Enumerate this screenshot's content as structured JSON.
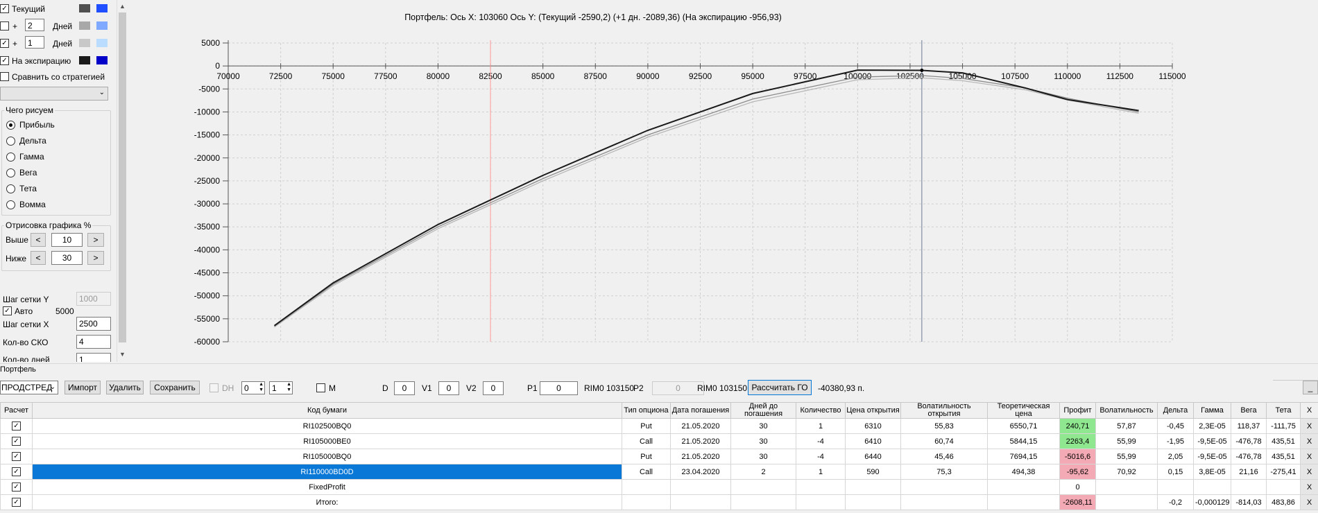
{
  "left": {
    "current_label": "Текущий",
    "plus1": "+",
    "days1": "2",
    "days_label1": "Дней",
    "plus2": "+",
    "days2": "1",
    "days_label2": "Дней",
    "expiry_label": "На экспирацию",
    "compare_label": "Сравнить со стратегией",
    "swatch_colors": [
      "#505050",
      "#1f4fff",
      "#a8a8a8",
      "#7fa8ff",
      "#c8c8c8",
      "#b9dcff",
      "#1a1a1a",
      "#0000c8"
    ],
    "draw_group_title": "Чего рисуем",
    "draw_options": [
      "Прибыль",
      "Дельта",
      "Гамма",
      "Вега",
      "Тета",
      "Вомма"
    ],
    "draw_selected": "Прибыль",
    "render_group_title": "Отрисовка графика %",
    "above_label": "Выше",
    "above_value": "10",
    "below_label": "Ниже",
    "below_value": "30",
    "less_btn": "<",
    "more_btn": ">",
    "grid_y_label": "Шаг сетки Y",
    "grid_y_value": "1000",
    "auto_label": "Авто",
    "auto_value": "5000",
    "grid_x_label": "Шаг сетки X",
    "grid_x_value": "2500",
    "sko_label": "Кол-во СКО",
    "sko_value": "4",
    "days_count_label": "Кол-во дней",
    "days_count_value": "1"
  },
  "chart_header": "Портфель:  Ось X:  103060  Ось Y:   (Текущий -2590,2)   (+1 дн. -2089,36)   (На экспирацию -956,93)",
  "chart_data": {
    "type": "line",
    "title": "Портфель:  Ось X:  103060  Ось Y:   (Текущий -2590,2)   (+1 дн. -2089,36)   (На экспирацию -956,93)",
    "xlim": [
      70000,
      115000
    ],
    "ylim": [
      -60000,
      5000
    ],
    "x_ticks": [
      70000,
      72500,
      75000,
      77500,
      80000,
      82500,
      85000,
      87500,
      90000,
      92500,
      95000,
      97500,
      100000,
      102500,
      105000,
      107500,
      110000,
      112500,
      115000
    ],
    "y_ticks": [
      5000,
      0,
      -5000,
      -10000,
      -15000,
      -20000,
      -25000,
      -30000,
      -35000,
      -40000,
      -45000,
      -50000,
      -55000,
      -60000
    ],
    "grid": true,
    "vlines": [
      {
        "x": 82500,
        "color": "#ff9a9a"
      },
      {
        "x": 103060,
        "color": "#6a7a90"
      }
    ],
    "series": [
      {
        "color": "#1a1a1a",
        "x": [
          72200,
          75000,
          80000,
          85000,
          90000,
          95000,
          100000,
          103060,
          105000,
          108000,
          110000,
          113400
        ],
        "y": [
          -56500,
          -47200,
          -34500,
          -23800,
          -14000,
          -6000,
          -900,
          -956,
          -1500,
          -4800,
          -7300,
          -9700
        ]
      },
      {
        "color": "#8a8a8a",
        "x": [
          72200,
          75000,
          80000,
          85000,
          90000,
          95000,
          100000,
          103060,
          105000,
          108000,
          110000,
          113400
        ],
        "y": [
          -56600,
          -47500,
          -35000,
          -24500,
          -15000,
          -7200,
          -2400,
          -2089,
          -2700,
          -4800,
          -7000,
          -10000
        ]
      },
      {
        "color": "#b8b8b8",
        "x": [
          72200,
          75000,
          80000,
          85000,
          90000,
          95000,
          100000,
          103060,
          105000,
          108000,
          110000,
          113400
        ],
        "y": [
          -56800,
          -47800,
          -35400,
          -25000,
          -15500,
          -7800,
          -3000,
          -2590,
          -3200,
          -5200,
          -7400,
          -10300
        ]
      }
    ]
  },
  "portfolio": {
    "label": "Портфель",
    "mode_select": "ПРОДСТРЕД",
    "import_btn": "Импорт",
    "delete_btn": "Удалить",
    "save_btn": "Сохранить",
    "dh_label": "DH",
    "dh_val1": "0",
    "dh_val2": "1",
    "m_label": "M",
    "d_label": "D",
    "d_value": "0",
    "v1_label": "V1",
    "v1_value": "0",
    "v2_label": "V2",
    "v2_value": "0",
    "p1_label": "P1",
    "p1_value": "0",
    "rim1": "RIM0 103150",
    "p2_label": "P2",
    "p2_value": "0",
    "rim2": "RIM0 103150",
    "calc_go_btn": "Рассчитать ГО",
    "go_value": "-40380,93 п.",
    "minimize_btn": "_"
  },
  "table": {
    "headers": [
      "Расчет",
      "Код бумаги",
      "Тип опциона",
      "Дата погашения",
      "Дней до погашения",
      "Количество",
      "Цена открытия",
      "Волатильность открытия",
      "Теоретическая цена",
      "Профит",
      "Волатильность",
      "Дельта",
      "Гамма",
      "Вега",
      "Тета",
      "X"
    ],
    "rows": [
      {
        "code": "RI102500BQ0",
        "type": "Put",
        "date": "21.05.2020",
        "days": "30",
        "qty": "1",
        "open": "6310",
        "vol_open": "55,83",
        "theor": "6550,71",
        "profit": "240,71",
        "profit_color": "green",
        "vol": "57,87",
        "delta": "-0,45",
        "gamma": "2,3E-05",
        "vega": "118,37",
        "theta": "-111,75",
        "x": "X"
      },
      {
        "code": "RI105000BE0",
        "type": "Call",
        "date": "21.05.2020",
        "days": "30",
        "qty": "-4",
        "open": "6410",
        "vol_open": "60,74",
        "theor": "5844,15",
        "profit": "2263,4",
        "profit_color": "green",
        "vol": "55,99",
        "delta": "-1,95",
        "gamma": "-9,5E-05",
        "vega": "-476,78",
        "theta": "435,51",
        "x": "X"
      },
      {
        "code": "RI105000BQ0",
        "type": "Put",
        "date": "21.05.2020",
        "days": "30",
        "qty": "-4",
        "open": "6440",
        "vol_open": "45,46",
        "theor": "7694,15",
        "profit": "-5016,6",
        "profit_color": "red",
        "vol": "55,99",
        "delta": "2,05",
        "gamma": "-9,5E-05",
        "vega": "-476,78",
        "theta": "435,51",
        "x": "X"
      },
      {
        "code": "RI110000BD0D",
        "type": "Call",
        "date": "23.04.2020",
        "days": "2",
        "qty": "1",
        "open": "590",
        "vol_open": "75,3",
        "theor": "494,38",
        "profit": "-95,62",
        "profit_color": "red",
        "vol": "70,92",
        "delta": "0,15",
        "gamma": "3,8E-05",
        "vega": "21,16",
        "theta": "-275,41",
        "x": "X",
        "selected": true
      },
      {
        "code": "FixedProfit",
        "type": "",
        "date": "",
        "days": "",
        "qty": "",
        "open": "",
        "vol_open": "",
        "theor": "",
        "profit": "0",
        "profit_color": "",
        "vol": "",
        "delta": "",
        "gamma": "",
        "vega": "",
        "theta": "",
        "x": "X"
      },
      {
        "code": "Итого:",
        "type": "",
        "date": "",
        "days": "",
        "qty": "",
        "open": "",
        "vol_open": "",
        "theor": "",
        "profit": "-2608,11",
        "profit_color": "red",
        "vol": "",
        "delta": "-0,2",
        "gamma": "-0,000129",
        "vega": "-814,03",
        "theta": "483,86",
        "x": "X"
      }
    ]
  }
}
